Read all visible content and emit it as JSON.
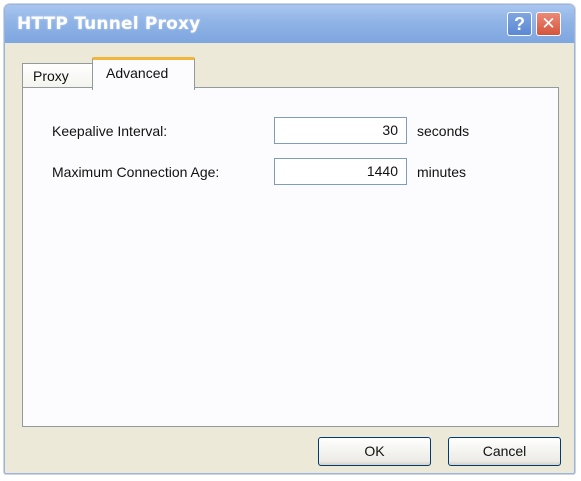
{
  "window": {
    "title": "HTTP Tunnel Proxy",
    "help_label": "?",
    "close_label": "✕"
  },
  "tabs": [
    {
      "label": "Proxy",
      "selected": false
    },
    {
      "label": "Advanced",
      "selected": true
    }
  ],
  "advanced": {
    "keepalive": {
      "label": "Keepalive Interval:",
      "value": "30",
      "unit": "seconds"
    },
    "max_age": {
      "label": "Maximum Connection Age:",
      "value": "1440",
      "unit": "minutes"
    }
  },
  "buttons": {
    "ok": "OK",
    "cancel": "Cancel"
  },
  "colors": {
    "titlebar": "#8fb3e6",
    "dialog_bg": "#ece9d8",
    "selected_tab_accent": "#f3b53c",
    "close_button": "#d4543c"
  }
}
